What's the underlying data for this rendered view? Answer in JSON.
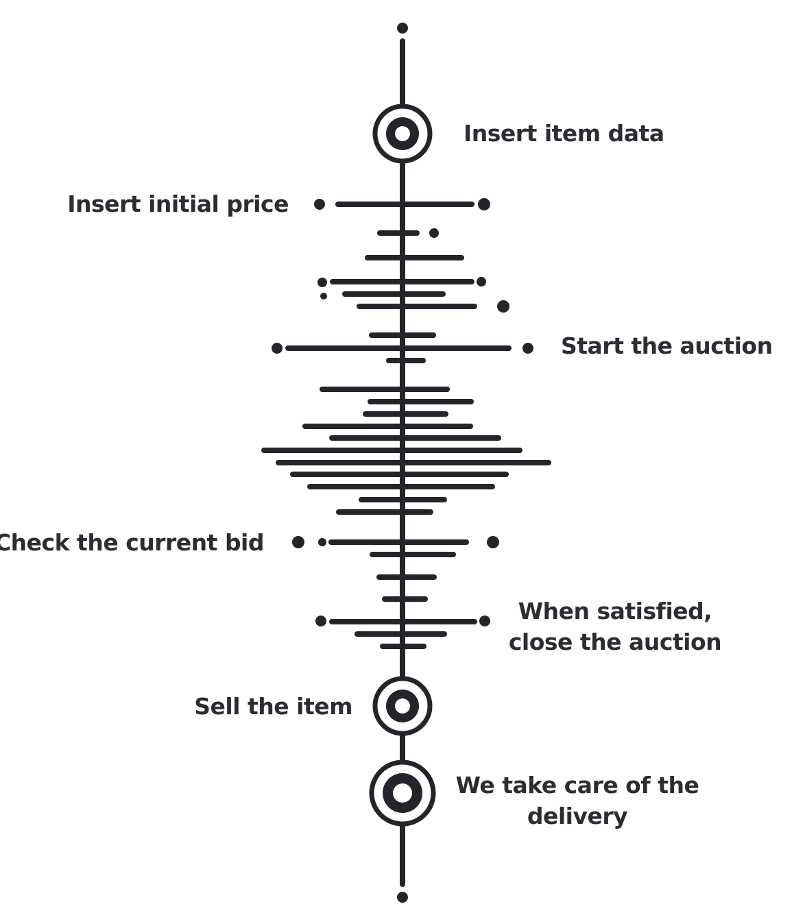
{
  "colors": {
    "ink": "#23252b",
    "label": "#2b2d33",
    "background": "#ffffff"
  },
  "steps": [
    {
      "label": "Insert item data"
    },
    {
      "label": "Insert initial price"
    },
    {
      "label": "Start the auction"
    },
    {
      "label": "Check the current bid"
    },
    {
      "label_line1": "When satisfied,",
      "label_line2": "close the auction"
    },
    {
      "label": "Sell the item"
    },
    {
      "label_line1": "We take care of the",
      "label_line2": "delivery"
    }
  ]
}
